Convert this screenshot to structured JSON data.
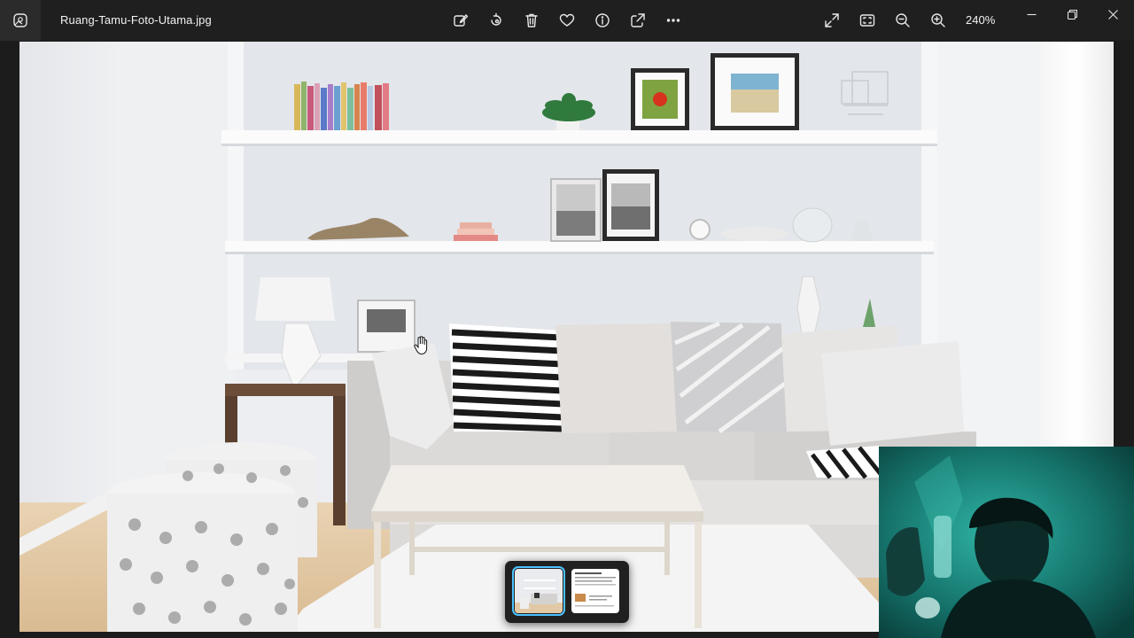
{
  "window": {
    "filename": "Ruang-Tamu-Foto-Utama.jpg",
    "zoom_level": "240%"
  },
  "toolbar": {
    "icons": [
      "edit-image-icon",
      "rotate-icon",
      "delete-icon",
      "favorite-heart-icon",
      "info-icon",
      "share-icon",
      "more-options-icon"
    ],
    "right_icons": [
      "fullscreen-icon",
      "fit-to-window-icon",
      "zoom-out-icon",
      "zoom-in-icon"
    ]
  },
  "window_controls": [
    "minimize-icon",
    "restore-icon",
    "close-icon"
  ],
  "filmstrip": {
    "count": 2,
    "selected_index": 0
  },
  "colors": {
    "titlebar": "#1f1f1f",
    "accent": "#4cc2ff",
    "wall": "#e9ebee",
    "webcam_tint": "#1a8a80"
  }
}
